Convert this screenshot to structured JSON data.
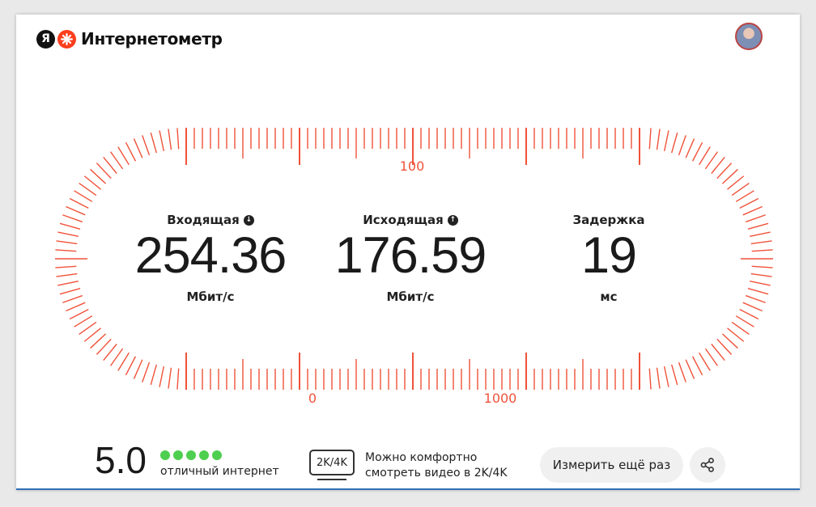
{
  "header": {
    "logo_letter": "Я",
    "app_title": "Интернетометр"
  },
  "gauge": {
    "color": "#f0523a",
    "scale_labels": {
      "top": "100",
      "bottom_left": "0",
      "bottom_right": "1000"
    }
  },
  "metrics": {
    "download": {
      "label": "Входящая",
      "icon": "arrow-down-icon",
      "value": "254.36",
      "unit": "Мбит/с"
    },
    "upload": {
      "label": "Исходящая",
      "icon": "arrow-up-icon",
      "value": "176.59",
      "unit": "Мбит/с"
    },
    "latency": {
      "label": "Задержка",
      "value": "19",
      "unit": "мс"
    }
  },
  "rating": {
    "score": "5.0",
    "stars_filled": 5,
    "stars_total": 5,
    "star_color": "#4fcf4f",
    "text": "отличный интернет"
  },
  "quality": {
    "badge": "2K/4K",
    "line1": "Можно комфортно",
    "line2": "смотреть видео в 2K/4K"
  },
  "actions": {
    "repeat_label": "Измерить ещё раз",
    "share_icon": "share-icon"
  }
}
